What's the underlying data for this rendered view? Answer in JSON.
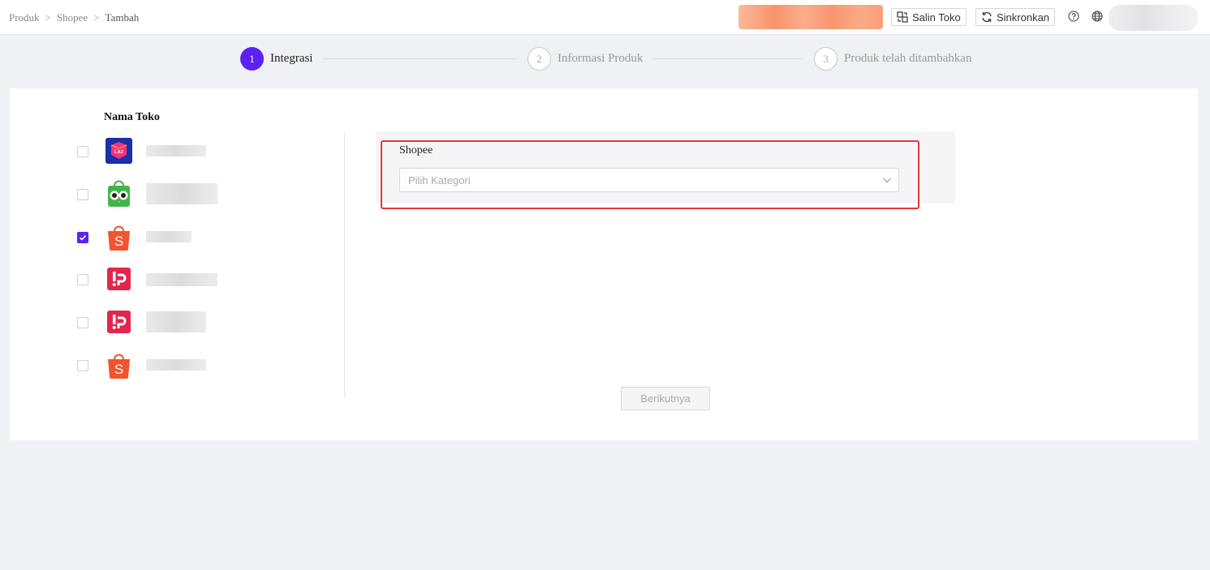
{
  "breadcrumb": {
    "item1": "Produk",
    "item2": "Shopee",
    "item3": "Tambah",
    "separator": ">"
  },
  "header": {
    "copy_store_label": "Salin Toko",
    "sync_label": "Sinkronkan",
    "help_icon": "question-circle-icon",
    "language_icon": "globe-icon"
  },
  "steps": [
    {
      "number": "1",
      "label": "Integrasi",
      "state": "active"
    },
    {
      "number": "2",
      "label": "Informasi Produk",
      "state": "inactive"
    },
    {
      "number": "3",
      "label": "Produk telah ditambahkan",
      "state": "inactive"
    }
  ],
  "stores": {
    "title": "Nama Toko",
    "items": [
      {
        "platform": "lazada",
        "checked": false
      },
      {
        "platform": "tokopedia",
        "checked": false
      },
      {
        "platform": "shopee",
        "checked": true
      },
      {
        "platform": "blibli",
        "checked": false
      },
      {
        "platform": "blibli",
        "checked": false
      },
      {
        "platform": "shopee",
        "checked": false
      }
    ]
  },
  "panel": {
    "label": "Shopee",
    "category_placeholder": "Pilih Kategori"
  },
  "next_button": "Berikutnya",
  "colors": {
    "accent": "#5b22f2",
    "highlight": "#e53935",
    "shopee": "#f3532e",
    "blibli": "#e2264d",
    "lazada": "#1a2fa8",
    "tokopedia": "#42b549"
  }
}
